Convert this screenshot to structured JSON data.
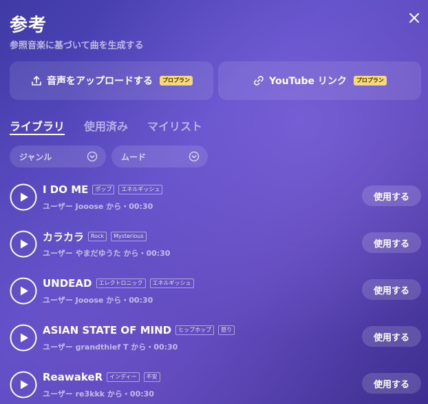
{
  "header": {
    "title": "参考",
    "subtitle": "参照音楽に基づいて曲を生成する"
  },
  "upload": {
    "audio_label": "音声をアップロードする",
    "audio_badge": "プロプラン",
    "youtube_label": "YouTube リンク",
    "youtube_badge": "プロプラン"
  },
  "tabs": [
    {
      "label": "ライブラリ",
      "active": true
    },
    {
      "label": "使用済み",
      "active": false
    },
    {
      "label": "マイリスト",
      "active": false
    }
  ],
  "filters": {
    "genre": "ジャンル",
    "mood": "ムード"
  },
  "tracks": [
    {
      "title": "I DO ME",
      "tags": [
        "ポップ",
        "エネルギッシュ"
      ],
      "meta": "ユーザー Jooose から・00:30",
      "action": "使用する"
    },
    {
      "title": "カラカラ",
      "tags": [
        "Rock",
        "Mysterious"
      ],
      "meta": "ユーザー やまだゆうた から・00:30",
      "action": "使用する"
    },
    {
      "title": "UNDEAD",
      "tags": [
        "エレクトロニック",
        "エネルギッシュ"
      ],
      "meta": "ユーザー Jooose から・00:30",
      "action": "使用する"
    },
    {
      "title": "ASIAN STATE OF MIND",
      "tags": [
        "ヒップホップ",
        "怒り"
      ],
      "meta": "ユーザー grandthief T から・00:30",
      "action": "使用する"
    },
    {
      "title": "ReawakeR",
      "tags": [
        "インディー",
        "不安"
      ],
      "meta": "ユーザー re3kkk から・00:30",
      "action": "使用する"
    }
  ],
  "colors": {
    "badge": "#f5d97a",
    "text": "#ffffff"
  }
}
